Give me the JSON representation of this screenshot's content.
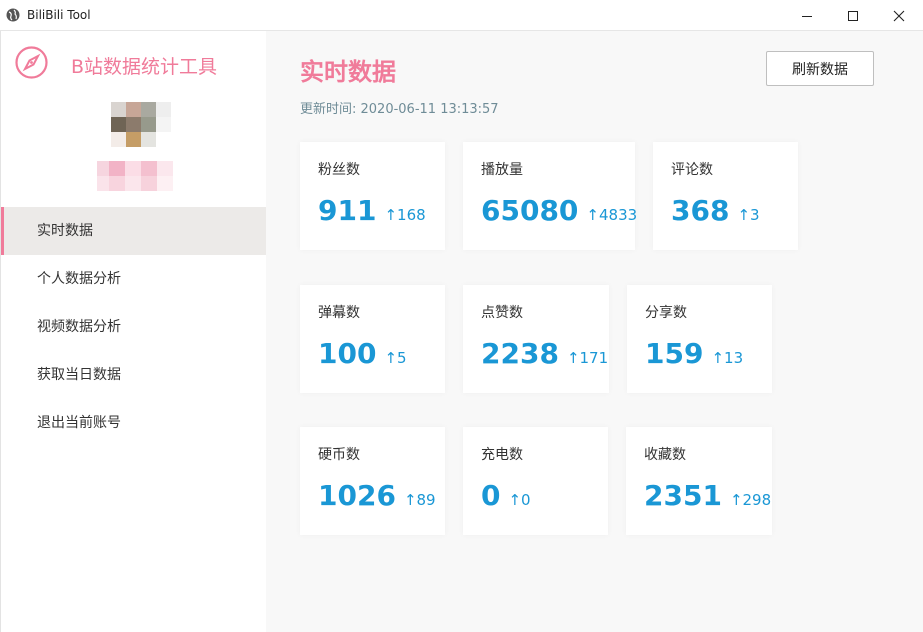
{
  "window": {
    "title": "BiliBili Tool"
  },
  "sidebar": {
    "app_name": "B站数据统计工具",
    "menu": [
      {
        "label": "实时数据",
        "active": true
      },
      {
        "label": "个人数据分析",
        "active": false
      },
      {
        "label": "视频数据分析",
        "active": false
      },
      {
        "label": "获取当日数据",
        "active": false
      },
      {
        "label": "退出当前账号",
        "active": false
      }
    ]
  },
  "header": {
    "title": "实时数据",
    "update_time": "更新时间: 2020-06-11 13:13:57",
    "refresh_label": "刷新数据"
  },
  "stats": [
    {
      "label": "粉丝数",
      "value": "911",
      "delta": "↑168"
    },
    {
      "label": "播放量",
      "value": "65080",
      "delta": "↑4833"
    },
    {
      "label": "评论数",
      "value": "368",
      "delta": "↑3"
    },
    {
      "label": "弹幕数",
      "value": "100",
      "delta": "↑5"
    },
    {
      "label": "点赞数",
      "value": "2238",
      "delta": "↑171"
    },
    {
      "label": "分享数",
      "value": "159",
      "delta": "↑13"
    },
    {
      "label": "硬币数",
      "value": "1026",
      "delta": "↑89"
    },
    {
      "label": "充电数",
      "value": "0",
      "delta": "↑0"
    },
    {
      "label": "收藏数",
      "value": "2351",
      "delta": "↑298"
    }
  ],
  "colors": {
    "accent_pink": "#f07b9a",
    "value_blue": "#1a97d5",
    "muted_text": "#6f8c97"
  },
  "icons": {
    "window": "globe-icon",
    "logo": "compass-icon"
  }
}
